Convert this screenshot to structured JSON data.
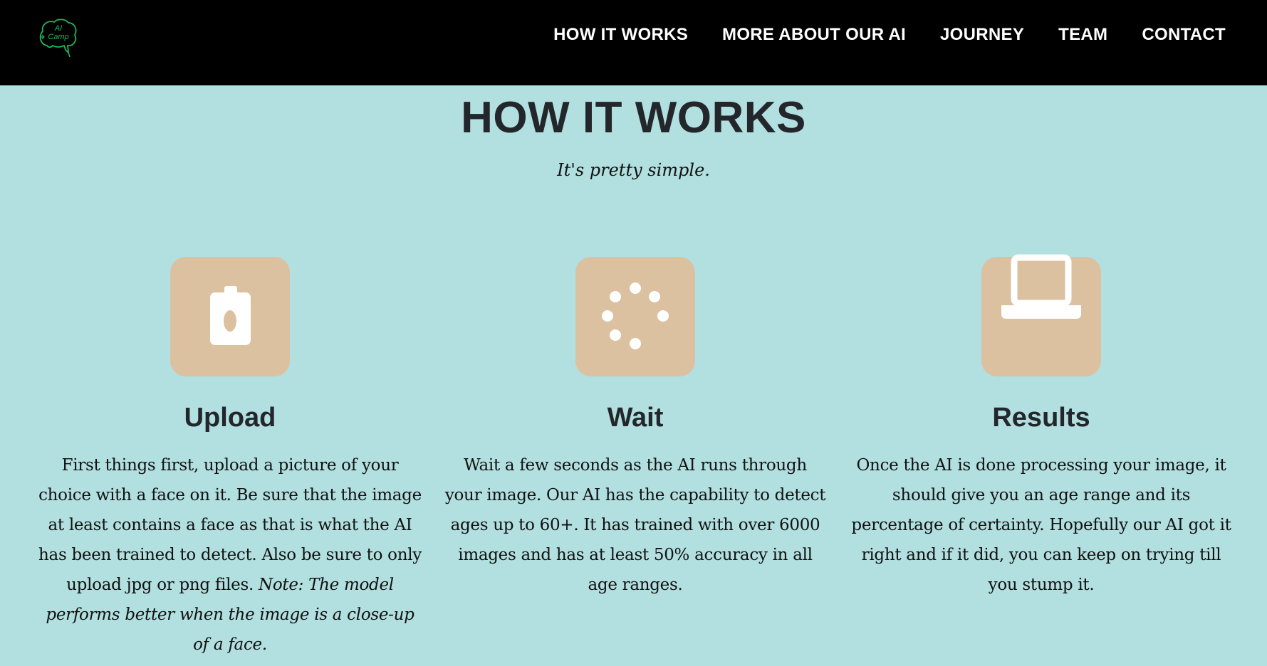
{
  "nav": {
    "logo_text_line1": "AI",
    "logo_text_line2": "Camp",
    "links": [
      {
        "label": "HOW IT WORKS"
      },
      {
        "label": "MORE ABOUT OUR AI"
      },
      {
        "label": "JOURNEY"
      },
      {
        "label": "TEAM"
      },
      {
        "label": "CONTACT"
      }
    ]
  },
  "section": {
    "title": "HOW IT WORKS",
    "subtitle": "It's pretty simple."
  },
  "steps": [
    {
      "title": "Upload",
      "icon": "camera-icon",
      "text": "First things first, upload a picture of your choice with a face on it. Be sure that the image at least contains a face as that is what the AI has been trained to detect. Also be sure to only upload jpg or png files. ",
      "note": "Note: The model performs better when the image is a close-up of a face."
    },
    {
      "title": "Wait",
      "icon": "loading-spinner-icon",
      "text": "Wait a few seconds as the AI runs through your image. Our AI has the capability to detect ages up to 60+. It has trained with over 6000 images and has at least 50% accuracy in all age ranges."
    },
    {
      "title": "Results",
      "icon": "laptop-icon",
      "text": "Once the AI is done processing your image, it should give you an age range and its percentage of certainty. Hopefully our AI got it right and if it did, you can keep on trying till you stump it."
    }
  ],
  "colors": {
    "page_background": "#b2dfdf",
    "navbar_background": "#000000",
    "icon_tile": "#dcc1a0",
    "logo_green": "#1db85a",
    "heading_text": "#23272b"
  }
}
